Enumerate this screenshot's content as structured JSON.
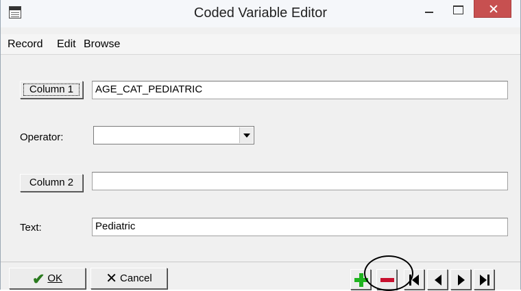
{
  "window": {
    "title": "Coded Variable Editor"
  },
  "menu": {
    "items": [
      {
        "label": "Record"
      },
      {
        "label": "Edit"
      },
      {
        "label": "Browse"
      }
    ]
  },
  "form": {
    "column1": {
      "button_label": "Column 1",
      "value": "AGE_CAT_PEDIATRIC"
    },
    "operator": {
      "label": "Operator:",
      "selected": ""
    },
    "column2": {
      "button_label": "Column 2",
      "value": ""
    },
    "text": {
      "label": "Text:",
      "value": "Pediatric"
    }
  },
  "toolbar": {
    "ok_label": "OK",
    "cancel_label": "Cancel",
    "ok_icon": "check-icon",
    "cancel_icon": "x-icon",
    "nav_icons": [
      "plus-icon",
      "minus-icon",
      "first-icon",
      "prev-icon",
      "next-icon",
      "last-icon"
    ]
  },
  "colors": {
    "close_button": "#c75050",
    "add_icon": "#1fb31f",
    "delete_icon": "#c8102e",
    "ok_check": "#2a7a1e"
  }
}
